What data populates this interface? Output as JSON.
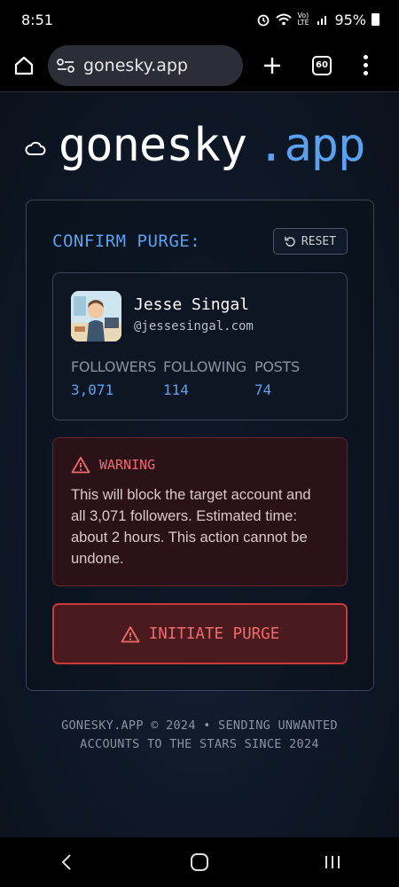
{
  "status_bar": {
    "time": "8:51",
    "network_label": "Vo) LTE",
    "battery": "95%",
    "icons": [
      "alarm-icon",
      "wifi-icon",
      "signal-icon",
      "battery-icon"
    ]
  },
  "browser": {
    "url": "gonesky.app",
    "tab_count": "60",
    "icons": [
      "home-icon",
      "site-settings-icon",
      "new-tab-icon",
      "tabs-icon",
      "menu-icon"
    ]
  },
  "logo": {
    "name": "gonesky",
    "tld": ".app",
    "icon": "cloud-icon"
  },
  "card": {
    "title": "CONFIRM PURGE:",
    "reset_label": "RESET",
    "profile": {
      "display_name": "Jesse Singal",
      "handle": "@jessesingal.com",
      "stats": [
        {
          "label": "FOLLOWERS",
          "value": "3,071"
        },
        {
          "label": "FOLLOWING",
          "value": "114"
        },
        {
          "label": "POSTS",
          "value": "74"
        }
      ]
    },
    "warning": {
      "title": "WARNING",
      "text": "This will block the target account and all 3,071 followers. Estimated time: about 2 hours. This action cannot be undone."
    },
    "purge_label": "INITIATE PURGE"
  },
  "footer": {
    "line1": "GONESKY.APP © 2024 • SENDING UNWANTED",
    "line2": "ACCOUNTS TO THE STARS SINCE 2024"
  },
  "colors": {
    "accent": "#5aa2f0",
    "danger": "#ef6b6b",
    "background": "#0d1421"
  }
}
